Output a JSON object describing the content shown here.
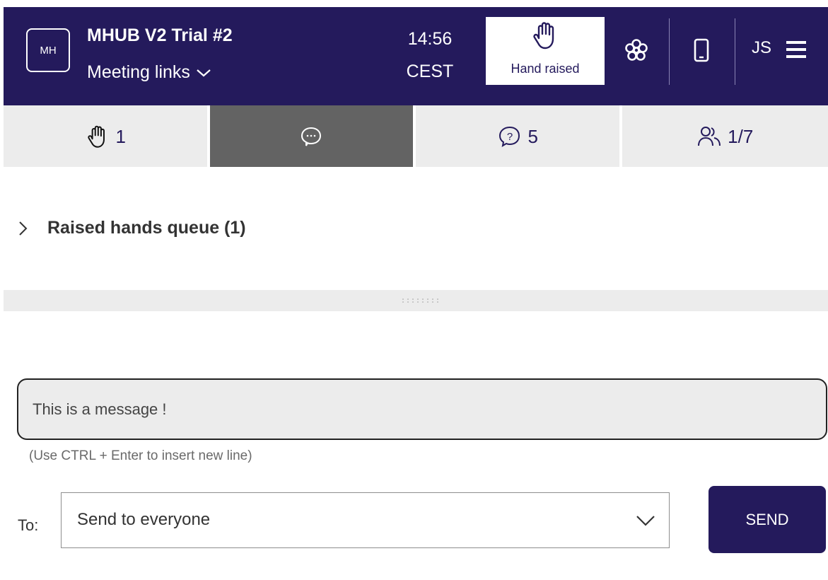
{
  "header": {
    "logo_text": "MH",
    "title": "MHUB V2 Trial #2",
    "meeting_links": "Meeting links",
    "time": "14:56",
    "timezone": "CEST",
    "hand_button_label": "Hand raised",
    "user_initials": "JS",
    "colors": {
      "background": "#241a5c",
      "text": "#ffffff"
    },
    "icons": [
      "hand-raised-icon",
      "flower-icon",
      "mobile-phone-icon",
      "hamburger-menu-icon"
    ]
  },
  "tabs": [
    {
      "icon": "raised-hand-icon",
      "count": "1"
    },
    {
      "icon": "chat-bubble-icon",
      "count": "",
      "active": true
    },
    {
      "icon": "question-icon",
      "count": "5"
    },
    {
      "icon": "participants-icon",
      "count": "1/7"
    }
  ],
  "queue": {
    "title": "Raised hands queue (1)"
  },
  "composer": {
    "message_value": "This is a message !",
    "hint": "(Use CTRL + Enter to insert new line)",
    "to_label": "To:",
    "recipient": "Send to everyone",
    "send_label": "SEND"
  },
  "colors": {
    "accent": "#241a5c",
    "tab_bg": "#ececec",
    "tab_active": "#636363"
  }
}
